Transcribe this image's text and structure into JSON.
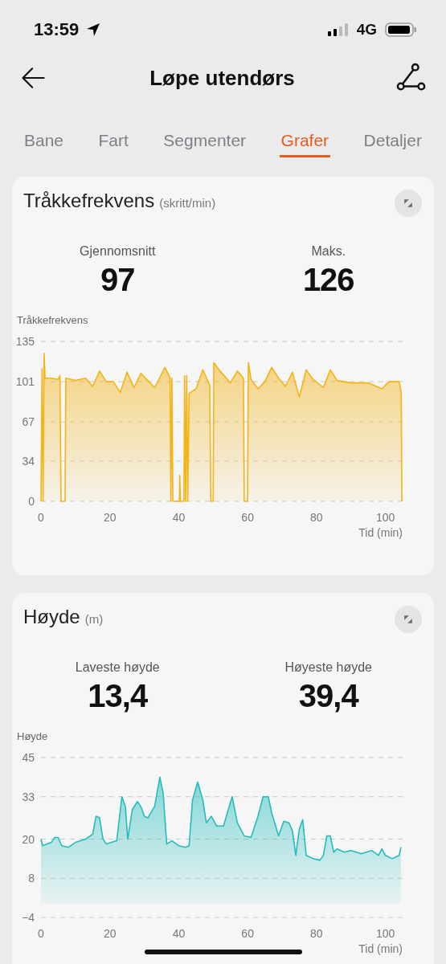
{
  "status_bar": {
    "time": "13:59",
    "network": "4G"
  },
  "header": {
    "title": "Løpe utendørs"
  },
  "tabs": [
    {
      "label": "Bane",
      "selected": false
    },
    {
      "label": "Fart",
      "selected": false
    },
    {
      "label": "Segmenter",
      "selected": false
    },
    {
      "label": "Grafer",
      "selected": true
    },
    {
      "label": "Detaljer",
      "selected": false
    }
  ],
  "cards": [
    {
      "title": "Tråkkefrekvens",
      "unit": "(skritt/min)",
      "stats": [
        {
          "label": "Gjennomsnitt",
          "value": "97"
        },
        {
          "label": "Maks.",
          "value": "126"
        }
      ],
      "chart_data": {
        "type": "area",
        "grid": true,
        "ylabel": "Tråkkefrekvens",
        "xlabel": "Tid (min)",
        "xlim": [
          0,
          105
        ],
        "ylim": [
          0,
          135
        ],
        "xticks": [
          0,
          20,
          40,
          60,
          80,
          100
        ],
        "yticks": [
          0,
          34,
          67,
          101,
          135
        ],
        "x": [
          0,
          0.3,
          0.6,
          0.9,
          1.2,
          3,
          5,
          5.5,
          5.8,
          7,
          7.2,
          10,
          13,
          15,
          17,
          19,
          21,
          23,
          25,
          27,
          29,
          31,
          33,
          36,
          37.5,
          37.7,
          38,
          38.3,
          40.2,
          40.3,
          40.5,
          41.5,
          41.7,
          42,
          42.3,
          42.6,
          43,
          45,
          47,
          49,
          49.3,
          50,
          50.2,
          52,
          55,
          57,
          58.8,
          59,
          60,
          60.2,
          61,
          63,
          65,
          67,
          69,
          71,
          73,
          75,
          77,
          79,
          82,
          84,
          86,
          88,
          90,
          95,
          99,
          101,
          104,
          104.6,
          104.8
        ],
        "series": [
          {
            "color": "#f3b418",
            "values": [
              0,
              112,
              0,
              125,
              104,
              104,
              103,
              106,
              0,
              0,
              104,
              102,
              104,
              97,
              110,
              101,
              101,
              92,
              109,
              96,
              108,
              102,
              96,
              113,
              104,
              0,
              104,
              0,
              0,
              22,
              0,
              0,
              106,
              0,
              106,
              0,
              91,
              95,
              111,
              98,
              0,
              0,
              117,
              110,
              100,
              110,
              104,
              0,
              0,
              117,
              103,
              95,
              101,
              113,
              104,
              97,
              109,
              88,
              111,
              103,
              96,
              111,
              102,
              101,
              100,
              100,
              95,
              101,
              101,
              91,
              0
            ]
          }
        ]
      }
    },
    {
      "title": "Høyde",
      "unit": "(m)",
      "stats": [
        {
          "label": "Laveste høyde",
          "value": "13,4"
        },
        {
          "label": "Høyeste høyde",
          "value": "39,4"
        }
      ],
      "chart_data": {
        "type": "area",
        "grid": true,
        "ylabel": "Høyde",
        "xlabel": "Tid (min)",
        "xlim": [
          0,
          105
        ],
        "ylim": [
          -4,
          45
        ],
        "xticks": [
          0,
          20,
          40,
          60,
          80,
          100
        ],
        "yticks": [
          -4,
          8,
          20,
          33,
          45
        ],
        "x": [
          0,
          0.5,
          3,
          4,
          5,
          6,
          8,
          10,
          13,
          15,
          16,
          17,
          18,
          19,
          22,
          23.5,
          24.5,
          25.2,
          26.5,
          28,
          29,
          30,
          31,
          33,
          34.5,
          35.5,
          36.5,
          38,
          40,
          42,
          43,
          44,
          45.5,
          47,
          48,
          49.5,
          51,
          53,
          55.5,
          57,
          59,
          61,
          63,
          64.5,
          66,
          67,
          69,
          70.5,
          72,
          73,
          74,
          75,
          76,
          77,
          79,
          81,
          82,
          83,
          84,
          85,
          86,
          88,
          90,
          93,
          96,
          98,
          99,
          100,
          102,
          104,
          104.5
        ],
        "series": [
          {
            "color": "#25bcbc",
            "values": [
              20,
              18,
              19,
              20.5,
              20.5,
              18,
              17.5,
              19,
              20,
              21.5,
              27,
              26.5,
              20,
              18.5,
              19.5,
              33,
              30,
              20,
              29,
              31.5,
              30,
              27,
              26.5,
              30,
              39,
              34,
              18.5,
              19.5,
              18,
              17.5,
              18,
              32,
              37.5,
              32,
              25,
              27,
              24,
              24,
              33,
              25,
              21,
              20.5,
              27,
              33,
              33,
              28,
              21,
              25.5,
              25,
              22.5,
              15,
              23,
              26,
              15,
              14,
              13.5,
              15,
              21,
              21,
              16,
              17,
              16,
              16.5,
              15.5,
              16.5,
              15,
              17,
              15,
              14,
              15,
              17.5
            ]
          }
        ]
      }
    }
  ]
}
